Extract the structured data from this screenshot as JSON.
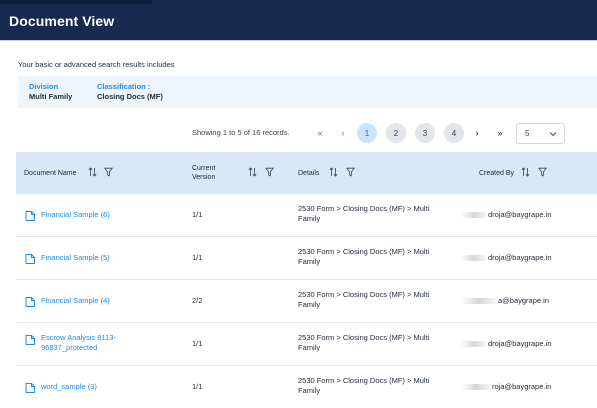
{
  "header": {
    "title": "Document View"
  },
  "intro_text": "Your basic or advanced search results includes",
  "criteria": {
    "division_label": "Division",
    "division_value": "Multi Family",
    "classification_label": "Classification :",
    "classification_value": "Closing Docs (MF)"
  },
  "pagination": {
    "records_text": "Showing 1 to 5 of 16 records.",
    "first": "«",
    "prev": "‹",
    "pages": [
      "1",
      "2",
      "3",
      "4"
    ],
    "active_page": "1",
    "next": "›",
    "last": "»",
    "page_size": "5"
  },
  "table": {
    "columns": {
      "document_name": "Document Name",
      "current_version_line1": "Current",
      "current_version_line2": "Version",
      "details": "Details",
      "created_by": "Created By"
    },
    "rows": [
      {
        "name": "Financial Sample (6)",
        "version": "1/1",
        "details_line1": "2530 Form > Closing Docs (MF) > Multi",
        "details_line2": "Family",
        "created_by": "droja@baygrape.in"
      },
      {
        "name": "Financial Sample (5)",
        "version": "1/1",
        "details_line1": "2530 Form > Closing Docs (MF) > Multi",
        "details_line2": "Family",
        "created_by": "droja@baygrape.in"
      },
      {
        "name": "Financial Sample (4)",
        "version": "2/2",
        "details_line1": "2530 Form > Closing Docs (MF) > Multi",
        "details_line2": "Family",
        "created_by": "a@baygrape.in"
      },
      {
        "name_line1": "Escrow Analysis 8113-",
        "name_line2": "96837_protected",
        "version": "1/1",
        "details_line1": "2530 Form > Closing Docs (MF) > Multi",
        "details_line2": "Family",
        "created_by": "droja@baygrape.in"
      },
      {
        "name": "word_sample (3)",
        "version": "1/1",
        "details_line1": "2530 Form > Closing Docs (MF) > Multi",
        "details_line2": "Family",
        "created_by": "roja@baygrape.in"
      }
    ]
  },
  "colors": {
    "header_bg": "#17294d",
    "link": "#1d8ce0",
    "table_header_bg": "#d9e8f7",
    "active_page_bg": "#c9e4fb"
  },
  "icons": [
    "file-icon",
    "sort-icon",
    "filter-icon",
    "chevron-down-icon"
  ]
}
